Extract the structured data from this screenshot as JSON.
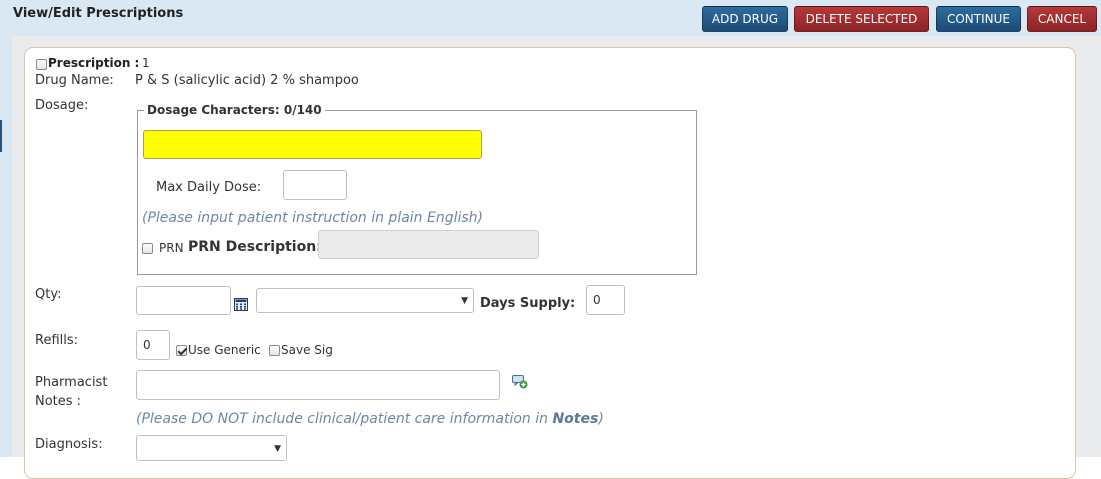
{
  "header": {
    "title": "View/Edit Prescriptions",
    "buttons": {
      "add_drug": "ADD DRUG",
      "delete_selected": "DELETE SELECTED",
      "continue": "CONTINUE",
      "cancel": "CANCEL"
    }
  },
  "prescription": {
    "label": "Prescription :",
    "number": "1",
    "drug_name_label": "Drug Name:",
    "drug_name": "P & S (salicylic acid) 2 % shampoo"
  },
  "dosage": {
    "label": "Dosage:",
    "legend": "Dosage Characters: 0/140",
    "sig_value": "",
    "max_daily_dose_label": "Max Daily Dose:",
    "max_daily_dose_value": "",
    "hint": "(Please input patient instruction in plain English)",
    "prn_checkbox_label": "PRN",
    "prn_description_label": "PRN Description:",
    "prn_description_value": ""
  },
  "qty": {
    "label": "Qty:",
    "value": "",
    "unit_selected": "",
    "days_supply_label": "Days Supply:",
    "days_supply_value": "0"
  },
  "refills": {
    "label": "Refills:",
    "value": "0",
    "use_generic_label": "Use Generic",
    "use_generic_checked": true,
    "save_sig_label": "Save Sig",
    "save_sig_checked": false
  },
  "pharmacist_notes": {
    "label_line1": "Pharmacist",
    "label_line2": "Notes :",
    "value": "",
    "hint_prefix": "(Please DO NOT include clinical/patient care information in ",
    "hint_bold": "Notes",
    "hint_suffix": ")"
  },
  "diagnosis": {
    "label": "Diagnosis:",
    "selected": ""
  },
  "colors": {
    "primary_button": "#2f6b9e",
    "danger_button": "#b4393c",
    "required_field": "#ffff00",
    "hint_text": "#6d87a3"
  }
}
